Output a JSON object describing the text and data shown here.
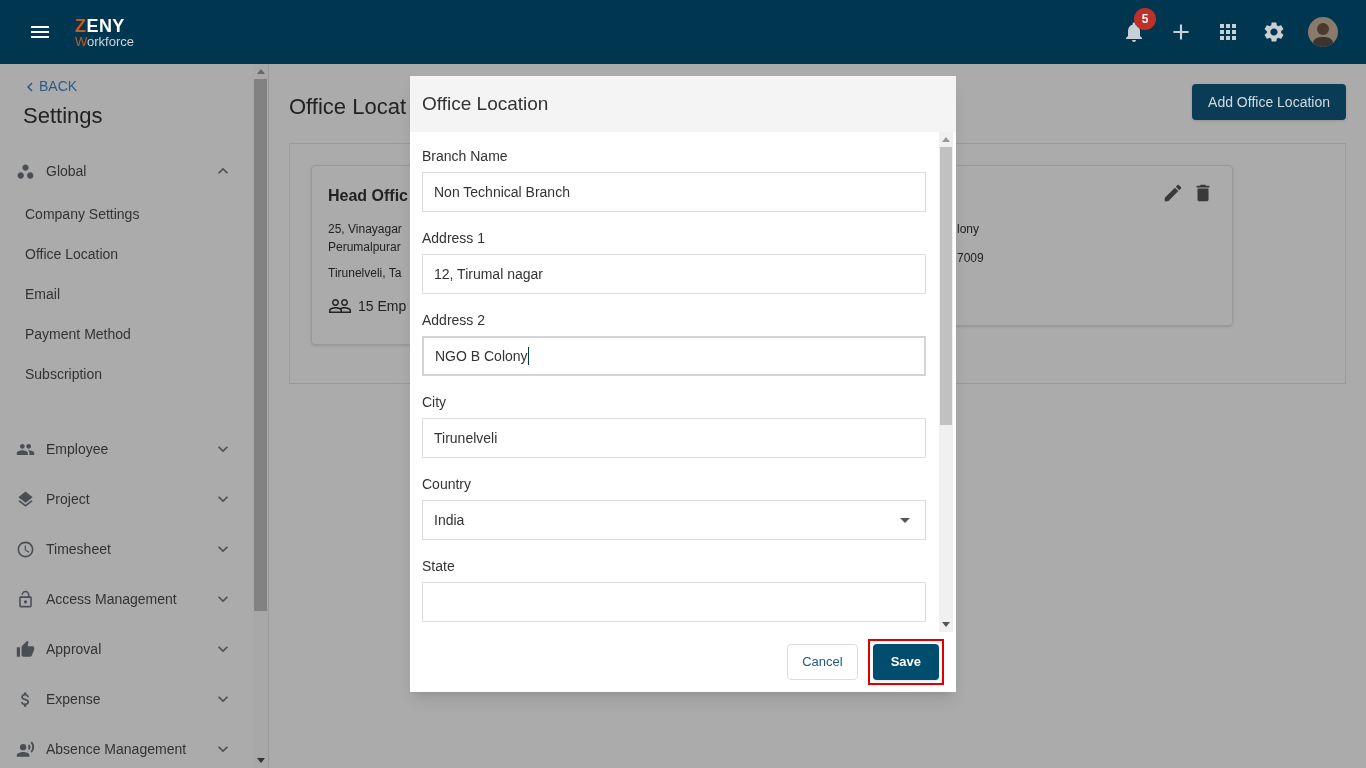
{
  "header": {
    "logo_top": "ZENY",
    "logo_bottom": "Workforce",
    "notification_count": "5"
  },
  "sidebar": {
    "back": "BACK",
    "title": "Settings",
    "groups": [
      {
        "label": "Global",
        "expanded": true,
        "children": [
          "Company Settings",
          "Office Location",
          "Email",
          "Payment Method",
          "Subscription"
        ]
      },
      {
        "label": "Employee",
        "expanded": false
      },
      {
        "label": "Project",
        "expanded": false
      },
      {
        "label": "Timesheet",
        "expanded": false
      },
      {
        "label": "Access Management",
        "expanded": false
      },
      {
        "label": "Approval",
        "expanded": false
      },
      {
        "label": "Expense",
        "expanded": false
      },
      {
        "label": "Absence Management",
        "expanded": false
      }
    ]
  },
  "main": {
    "title": "Office Locat",
    "add_button": "Add Office Location",
    "cards": [
      {
        "title": "Head Offic",
        "lines": [
          "25, Vinayagar",
          "Perumalpurar",
          "Tirunelveli, Ta"
        ],
        "employees": "15 Emp"
      },
      {
        "lines": [
          "lony",
          "7009"
        ]
      }
    ]
  },
  "dialog": {
    "title": "Office Location",
    "fields": [
      {
        "kind": "text",
        "label": "Branch Name",
        "value": "Non Technical Branch",
        "focused": false
      },
      {
        "kind": "text",
        "label": "Address 1",
        "value": "12, Tirumal nagar",
        "focused": false
      },
      {
        "kind": "text",
        "label": "Address 2",
        "value": "NGO B Colony",
        "focused": true
      },
      {
        "kind": "text",
        "label": "City",
        "value": "Tirunelveli",
        "focused": false
      },
      {
        "kind": "select",
        "label": "Country",
        "value": "India",
        "focused": false
      },
      {
        "kind": "text",
        "label": "State",
        "focused": false
      }
    ],
    "cancel": "Cancel",
    "save": {
      "label": "Save",
      "highlighted": true
    }
  }
}
